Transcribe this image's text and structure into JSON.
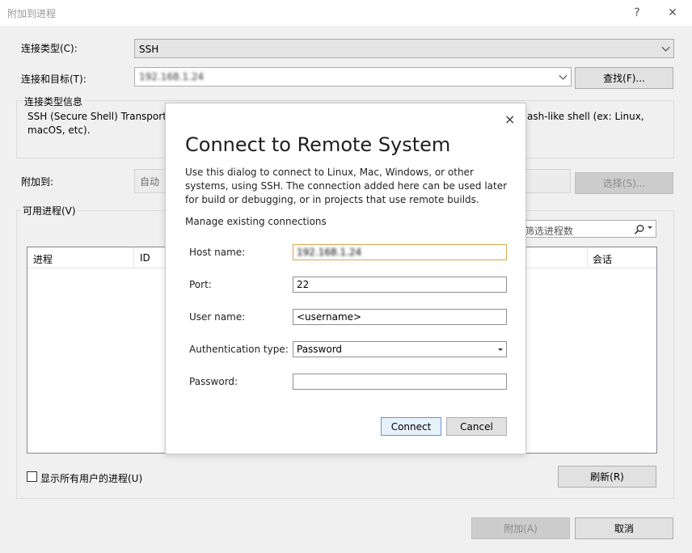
{
  "window": {
    "title": "附加到进程",
    "help_glyph": "?",
    "close_glyph": "✕"
  },
  "form": {
    "connection_type_label": "连接类型(C):",
    "connection_type_value": "SSH",
    "target_label": "连接和目标(T):",
    "target_value": "192.168.1.24",
    "find_button": "查找(F)...",
    "info_group_label": "连接类型信息",
    "info_text_left": "SSH (Secure Shell) Transport",
    "info_text_right": "ash-like shell (ex: Linux,",
    "info_text_line2": "macOS, etc).",
    "attach_to_label": "附加到:",
    "attach_to_value": "自动",
    "select_button": "选择(S)...",
    "available_processes_label": "可用进程(V)",
    "filter_placeholder": "筛选进程数",
    "columns": {
      "process": "进程",
      "id": "ID",
      "session": "会话"
    },
    "show_all_users_label": "显示所有用户的进程(U)",
    "refresh_button": "刷新(R)",
    "attach_button": "附加(A)",
    "cancel_button": "取消"
  },
  "dialog": {
    "close_glyph": "×",
    "title": "Connect to Remote System",
    "description": "Use this dialog to connect to Linux, Mac, Windows, or other systems, using SSH. The connection added here can be used later for build or debugging, or in projects that use remote builds.",
    "manage_link": "Manage existing connections",
    "host_label": "Host name:",
    "host_value": "192.168.1.24",
    "port_label": "Port:",
    "port_value": "22",
    "user_label": "User name:",
    "user_value": "<username>",
    "auth_label": "Authentication type:",
    "auth_value": "Password",
    "password_label": "Password:",
    "password_value": "",
    "connect_button": "Connect",
    "cancel_button": "Cancel"
  }
}
